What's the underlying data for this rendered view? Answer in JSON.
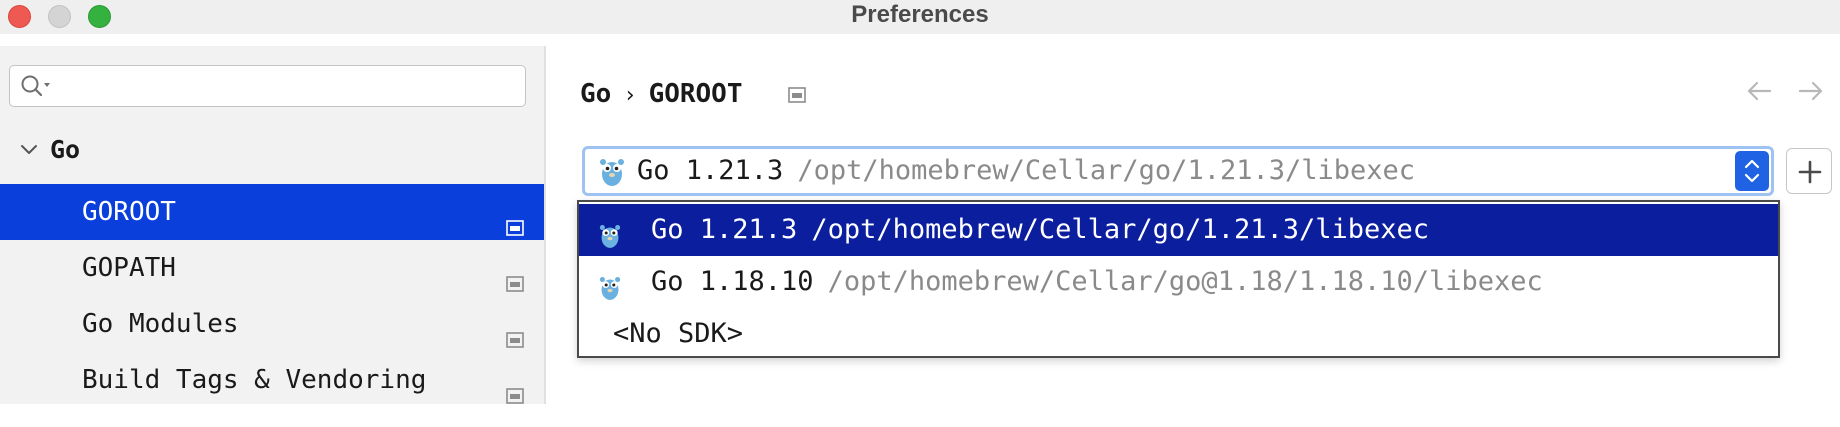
{
  "window": {
    "title": "Preferences"
  },
  "sidebar": {
    "search": {
      "value": "",
      "placeholder": ""
    },
    "group": {
      "label": "Go",
      "expanded": true
    },
    "items": [
      {
        "label": "GOROOT",
        "selected": true
      },
      {
        "label": "GOPATH",
        "selected": false
      },
      {
        "label": "Go Modules",
        "selected": false
      },
      {
        "label": "Build Tags & Vendoring",
        "selected": false
      }
    ]
  },
  "breadcrumb": {
    "parent": "Go",
    "current": "GOROOT"
  },
  "sdk_select": {
    "selected_version": "Go 1.21.3",
    "selected_path": "/opt/homebrew/Cellar/go/1.21.3/libexec"
  },
  "sdk_options": [
    {
      "version": "Go 1.21.3",
      "path": "/opt/homebrew/Cellar/go/1.21.3/libexec",
      "selected": true
    },
    {
      "version": "Go 1.18.10",
      "path": "/opt/homebrew/Cellar/go@1.18/1.18.10/libexec",
      "selected": false
    },
    {
      "label": "<No SDK>"
    }
  ],
  "colors": {
    "selection_sidebar": "#0a3fdc",
    "selection_popup": "#0a1e9e",
    "path_gray": "#8a8a8a",
    "focus_ring": "#9ec2f2",
    "stepper": "#1f63e4"
  },
  "icons": {
    "close": "close-window-icon",
    "minimize": "minimize-window-icon",
    "maximize": "maximize-window-icon",
    "search": "search-icon",
    "expand": "chevron-down-icon",
    "page": "project-scope-icon",
    "back": "back-arrow-icon",
    "forward": "forward-arrow-icon",
    "sdk": "go-gopher-icon",
    "add": "plus-icon"
  }
}
